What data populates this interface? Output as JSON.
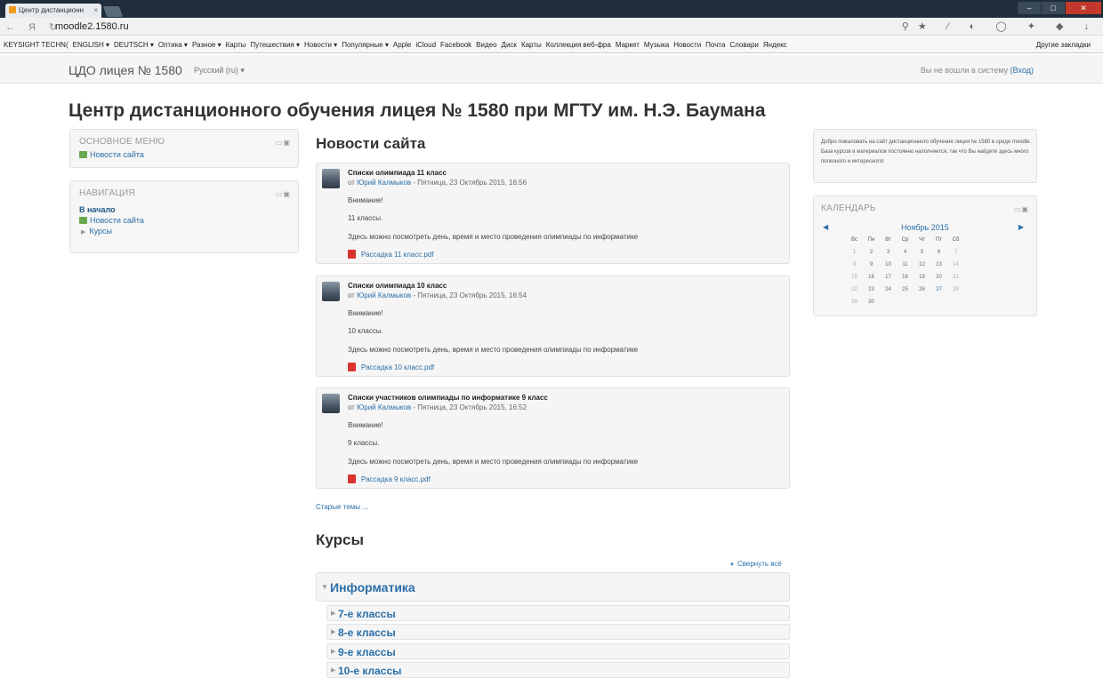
{
  "browser": {
    "tab_title": "Центр дистанционн",
    "url": "moodle2.1580.ru",
    "bookmarks": [
      "KEYSIGHT TECHN(",
      "ENGLISH ▾",
      "DEUTSCH ▾",
      "Оптика ▾",
      "Разное ▾",
      "Карты",
      "Путешествия ▾",
      "Новости ▾",
      "Популярные ▾",
      "Apple",
      "iCloud",
      "Facebook",
      "Видео",
      "Диск",
      "Карты",
      "Коллекция веб-фра",
      "Маркет",
      "Музыка",
      "Новости",
      "Почта",
      "Словари",
      "Яндекс"
    ],
    "other_bookmarks": "Другие закладки"
  },
  "header": {
    "brand": "ЦДО лицея № 1580",
    "language": "Русский (ru) ▾",
    "login_text": "Вы не вошли в систему",
    "login_link": "(Вход)"
  },
  "site_title": "Центр дистанционного обучения лицея № 1580 при МГТУ им. Н.Э. Баумана",
  "main_menu": {
    "title": "ОСНОВНОЕ МЕНЮ",
    "item": "Новости сайта"
  },
  "navigation": {
    "title": "НАВИГАЦИЯ",
    "home": "В начало",
    "news": "Новости сайта",
    "courses": "Курсы"
  },
  "news": {
    "title": "Новости сайта",
    "posts": [
      {
        "title": "Списки олимпиада 11 класс",
        "author": "Юрий Калмыков",
        "date": " - Пятница, 23 Октябрь 2015, 16:56",
        "attention": "Внимание!",
        "grade": "11 классы.",
        "text": "Здесь можно посмотреть день, время и место проведения олимпиады по информатике",
        "attachment": "Рассадка 11 класс.pdf"
      },
      {
        "title": "Списки олимпиада 10 класс",
        "author": "Юрий Калмыков",
        "date": " - Пятница, 23 Октябрь 2015, 16:54",
        "attention": "Внимание!",
        "grade": "10 классы.",
        "text": "Здесь можно посмотреть день, время и место проведения олимпиады по информатике",
        "attachment": "Рассадка 10 класс.pdf"
      },
      {
        "title": "Списки участников олимпиады по информатике 9 класс",
        "author": "Юрий Калмыков",
        "date": " - Пятница, 23 Октябрь 2015, 16:52",
        "attention": "Внимание!",
        "grade": "9 классы.",
        "text": "Здесь можно посмотреть день, время и место проведения олимпиады по информатике",
        "attachment": "Рассадка 9 класс.pdf"
      }
    ],
    "from_label": "от ",
    "old_topics": "Старые темы ..."
  },
  "courses": {
    "title": "Курсы",
    "collapse_all": "Свернуть всё",
    "category": "Информатика",
    "subcategories": [
      "7-е классы",
      "8-е классы",
      "9-е классы",
      "10-е классы"
    ]
  },
  "welcome": {
    "text": "Добро пожаловать на сайт дистанционного обучения лицея № 1580 в среде moodle. База курсов и материалов постоянно наполняется, так что Вы найдете здесь много полезного и интересного!"
  },
  "calendar": {
    "title": "КАЛЕНДАРЬ",
    "month": "Ноябрь 2015",
    "weekdays": [
      "Вс",
      "Пн",
      "Вт",
      "Ср",
      "Чт",
      "Пт",
      "Сб"
    ],
    "weeks": [
      [
        "1",
        "2",
        "3",
        "4",
        "5",
        "6",
        "7"
      ],
      [
        "8",
        "9",
        "10",
        "11",
        "12",
        "13",
        "14"
      ],
      [
        "15",
        "16",
        "17",
        "18",
        "19",
        "20",
        "21"
      ],
      [
        "22",
        "23",
        "24",
        "25",
        "26",
        "27",
        "28"
      ],
      [
        "29",
        "30",
        "",
        "",
        "",
        "",
        ""
      ]
    ],
    "today": "27"
  },
  "colors": {
    "link": "#2a6fa8",
    "block_bg": "#f6f6f6",
    "titlebar": "#1f2d3d"
  }
}
